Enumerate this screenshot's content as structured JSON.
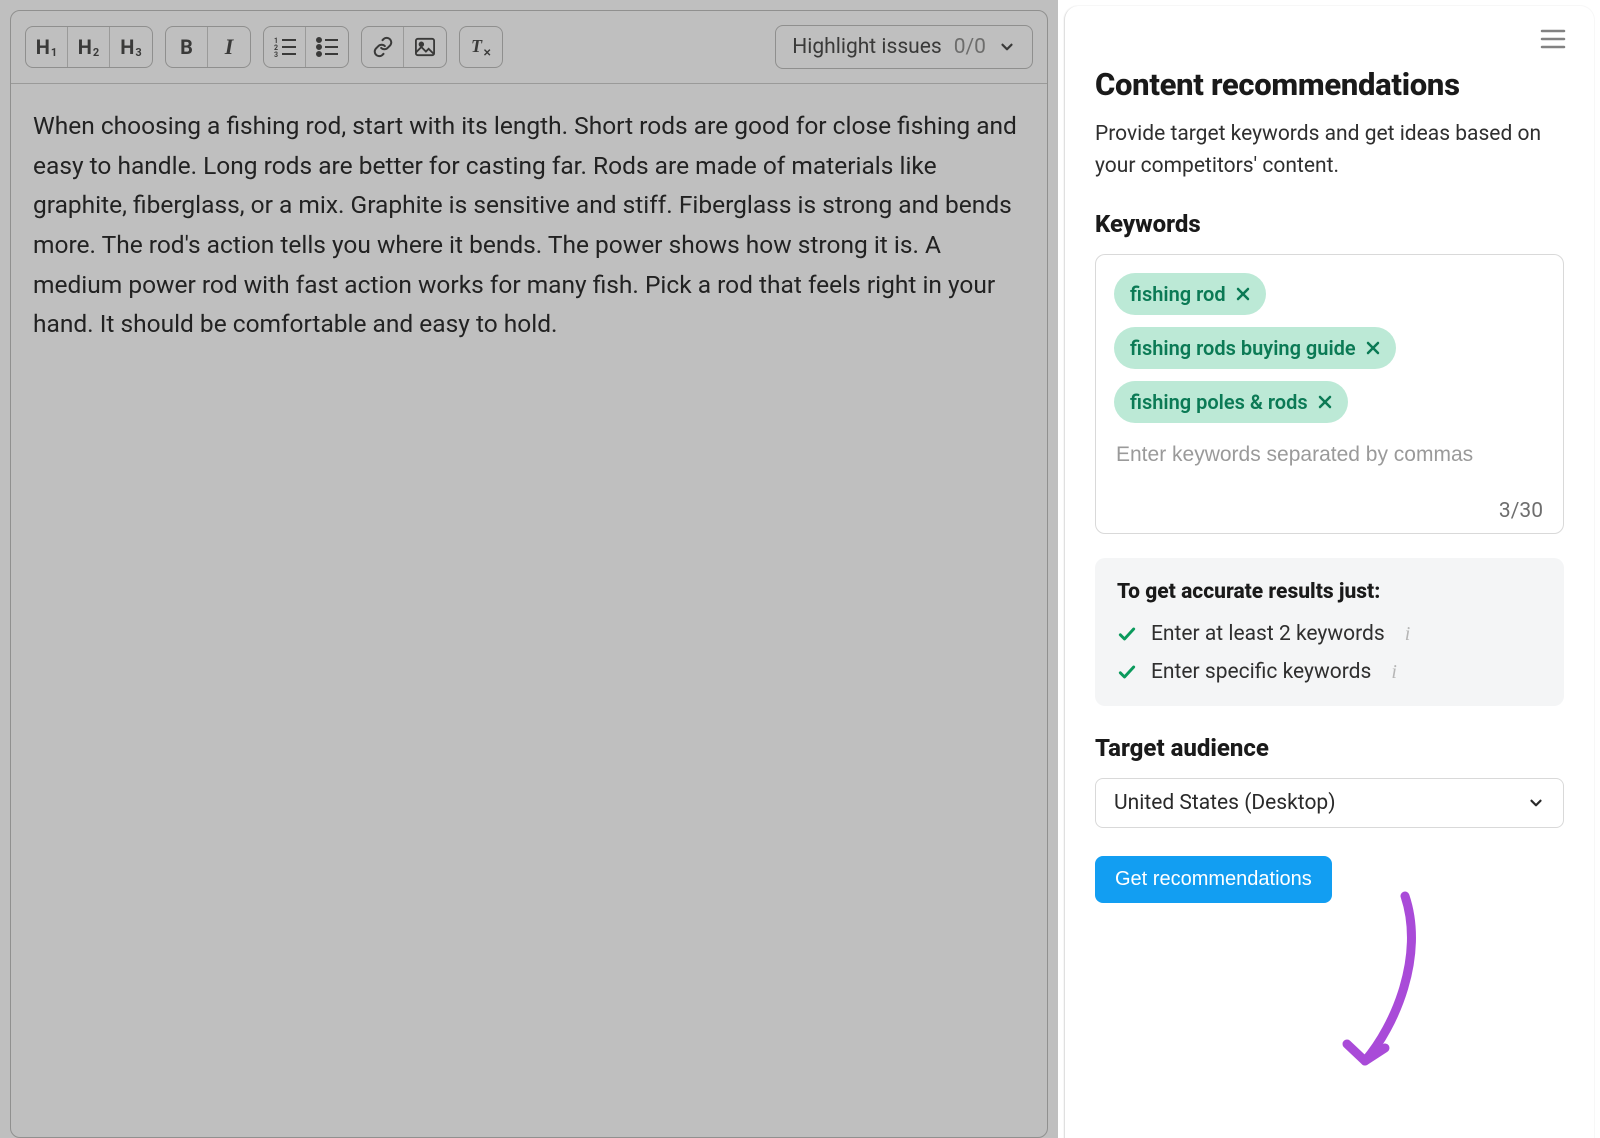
{
  "toolbar": {
    "h1": "H",
    "h1_sub": "1",
    "h2": "H",
    "h2_sub": "2",
    "h3": "H",
    "h3_sub": "3",
    "bold": "B",
    "italic": "I",
    "highlight_label": "Highlight issues",
    "highlight_count": "0/0"
  },
  "editor": {
    "text": "When choosing a fishing rod, start with its length. Short rods are good for close fishing and easy to handle. Long rods are better for casting far. Rods are made of materials like graphite, fiberglass, or a mix. Graphite is sensitive and stiff. Fiberglass is strong and bends more. The rod's action tells you where it bends. The power shows how strong it is. A medium power rod with fast action works for many fish. Pick a rod that feels right in your hand. It should be comfortable and easy to hold."
  },
  "sidebar": {
    "title": "Content recommendations",
    "description": "Provide target keywords and get ideas based on your competitors' content.",
    "keywords_heading": "Keywords",
    "keywords": [
      {
        "label": "fishing rod"
      },
      {
        "label": "fishing rods buying guide"
      },
      {
        "label": "fishing poles & rods"
      }
    ],
    "keywords_placeholder": "Enter keywords separated by commas",
    "keywords_count": "3/30",
    "tips": {
      "title": "To get accurate results just:",
      "items": [
        "Enter at least 2 keywords",
        "Enter specific keywords"
      ]
    },
    "audience_heading": "Target audience",
    "audience_value": "United States (Desktop)",
    "cta": "Get recommendations"
  },
  "colors": {
    "accent_blue": "#129ef2",
    "tag_bg": "#bce9d6",
    "tag_fg": "#0b7a55",
    "check_green": "#0a9a5c",
    "annotation_purple": "#a94bd8"
  }
}
